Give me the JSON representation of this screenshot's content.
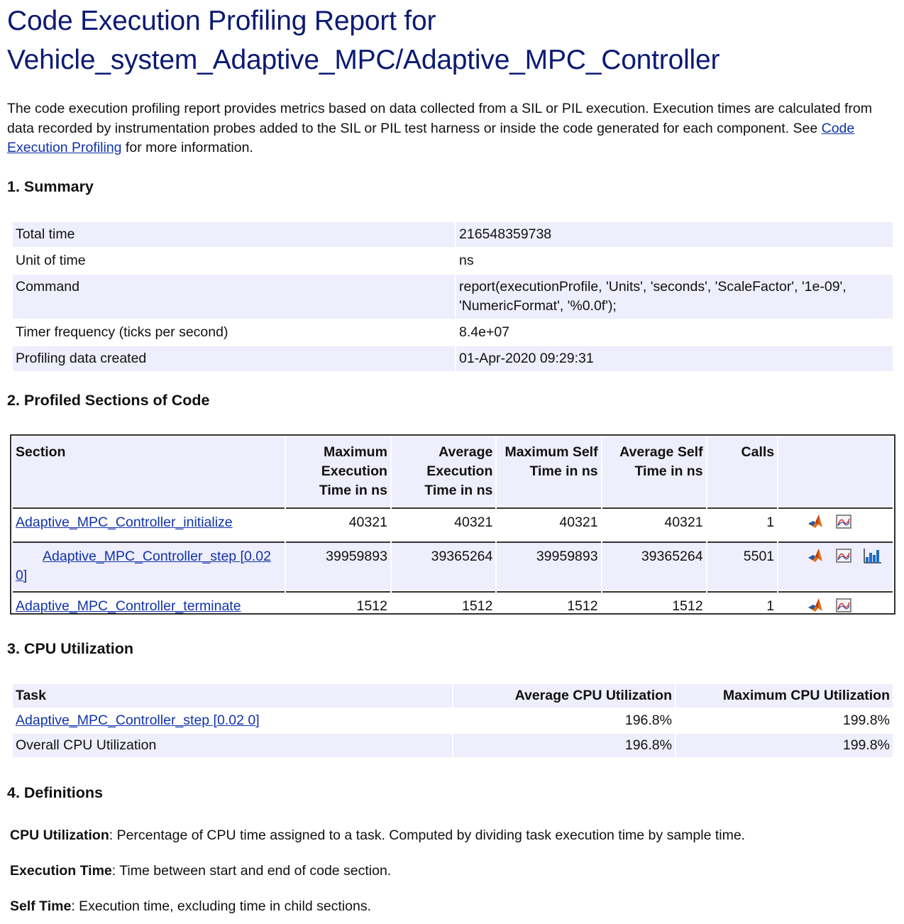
{
  "title_line1": "Code Execution Profiling Report for",
  "title_line2": "Vehicle_system_Adaptive_MPC/Adaptive_MPC_Controller",
  "intro": {
    "text1": "The code execution profiling report provides metrics based on data collected from a SIL or PIL execution. Execution times are calculated from data recorded by instrumentation probes added to the SIL or PIL test harness or inside the code generated for each component. See ",
    "link": "Code Execution Profiling",
    "text2": " for more information."
  },
  "summary": {
    "heading": "1. Summary",
    "rows": [
      {
        "label": "Total time",
        "value": "216548359738"
      },
      {
        "label": "Unit of time",
        "value": "ns"
      },
      {
        "label": "Command",
        "value": "report(executionProfile, 'Units', 'seconds', 'ScaleFactor', '1e-09', 'NumericFormat', '%0.0f');"
      },
      {
        "label": "Timer frequency (ticks per second)",
        "value": "8.4e+07"
      },
      {
        "label": "Profiling data created",
        "value": "01-Apr-2020 09:29:31"
      }
    ]
  },
  "sections": {
    "heading": "2. Profiled Sections of Code",
    "columns": [
      "Section",
      "Maximum Execution Time in ns",
      "Average Execution Time in ns",
      "Maximum Self Time in ns",
      "Average Self Time in ns",
      "Calls"
    ],
    "rows": [
      {
        "name": "Adaptive_MPC_Controller_initialize",
        "max_exec": "40321",
        "avg_exec": "40321",
        "max_self": "40321",
        "avg_self": "40321",
        "calls": "1"
      },
      {
        "name": "Adaptive_MPC_Controller_step [0.02 0]",
        "max_exec": "39959893",
        "avg_exec": "39365264",
        "max_self": "39959893",
        "avg_self": "39365264",
        "calls": "5501"
      },
      {
        "name": "Adaptive_MPC_Controller_terminate",
        "max_exec": "1512",
        "avg_exec": "1512",
        "max_self": "1512",
        "avg_self": "1512",
        "calls": "1"
      }
    ],
    "icons": [
      "matlab-icon",
      "plot-icon",
      "bar-chart-icon"
    ]
  },
  "cpu": {
    "heading": "3. CPU Utilization",
    "columns": [
      "Task",
      "Average CPU Utilization",
      "Maximum CPU Utilization"
    ],
    "rows": [
      {
        "task": "Adaptive_MPC_Controller_step [0.02 0]",
        "avg": "196.8%",
        "max": "199.8%"
      },
      {
        "task": "Overall CPU Utilization",
        "avg": "196.8%",
        "max": "199.8%"
      }
    ]
  },
  "definitions": {
    "heading": "4. Definitions",
    "items": [
      {
        "term": "CPU Utilization",
        "text": ": Percentage of CPU time assigned to a task. Computed by dividing task execution time by sample time."
      },
      {
        "term": "Execution Time",
        "text": ": Time between start and end of code section."
      },
      {
        "term": "Self Time",
        "text": ": Execution time, excluding time in child sections."
      }
    ]
  }
}
